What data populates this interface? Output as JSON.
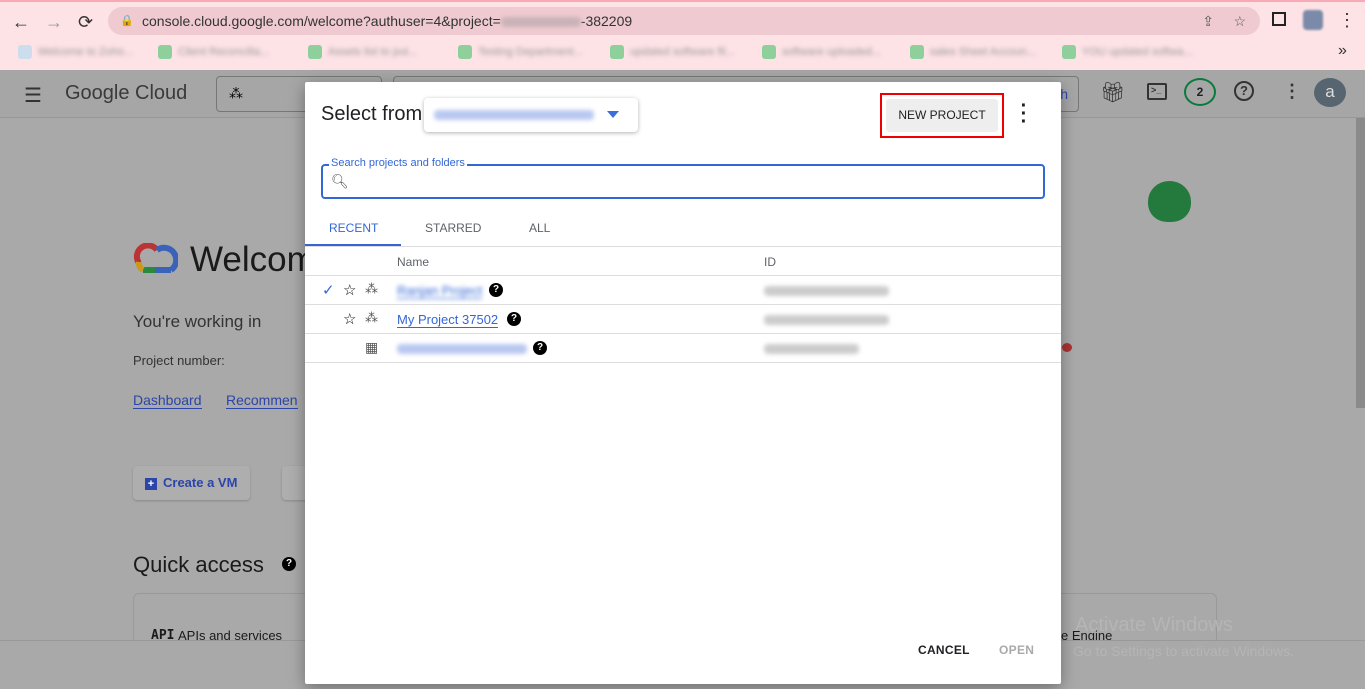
{
  "browser": {
    "back": "←",
    "forward": "→",
    "reload": "⟳",
    "url_prefix": "console.cloud.google.com/welcome?authuser=4&project=",
    "url_suffix": "-382209",
    "more": "⋮",
    "overflow": "»",
    "bookmarks": [
      "Welcome to Zoho...",
      "Client Reconcilia...",
      "Assets list to put...",
      "Testing Department...",
      "updated software fil...",
      "software uploaded...",
      "sales Sheet Accoun...",
      "YOU updated softwa..."
    ]
  },
  "app": {
    "brand": "Google Cloud",
    "notifications_count": "2",
    "avatar_letter": "a",
    "search_button_tail": "h"
  },
  "welcome": {
    "heading": "Welcom",
    "working_in": "You're working in",
    "project_number_label": "Project number:",
    "links": [
      "Dashboard",
      "Recommen"
    ],
    "create_vm": "Create a VM",
    "quick_access": "Quick access",
    "apis": "APIs and services",
    "apis_icon": "API",
    "engine": "e Engine"
  },
  "watermark": {
    "line1": "Activate Windows",
    "line2": "Go to Settings to activate Windows."
  },
  "dialog": {
    "title": "Select from",
    "new_project": "NEW PROJECT",
    "search_label": "Search projects and folders",
    "search_value": "",
    "tabs": [
      "RECENT",
      "STARRED",
      "ALL"
    ],
    "active_tab": "RECENT",
    "columns": {
      "name": "Name",
      "id": "ID"
    },
    "rows": [
      {
        "name": "Ranjan Project",
        "selected": true,
        "type": "project"
      },
      {
        "name": "My Project 37502",
        "selected": false,
        "type": "project"
      },
      {
        "name": "",
        "selected": false,
        "type": "organization"
      }
    ],
    "cancel": "CANCEL",
    "open": "OPEN"
  },
  "colors": {
    "accent": "#3367d6",
    "highlight": "#e00000"
  }
}
